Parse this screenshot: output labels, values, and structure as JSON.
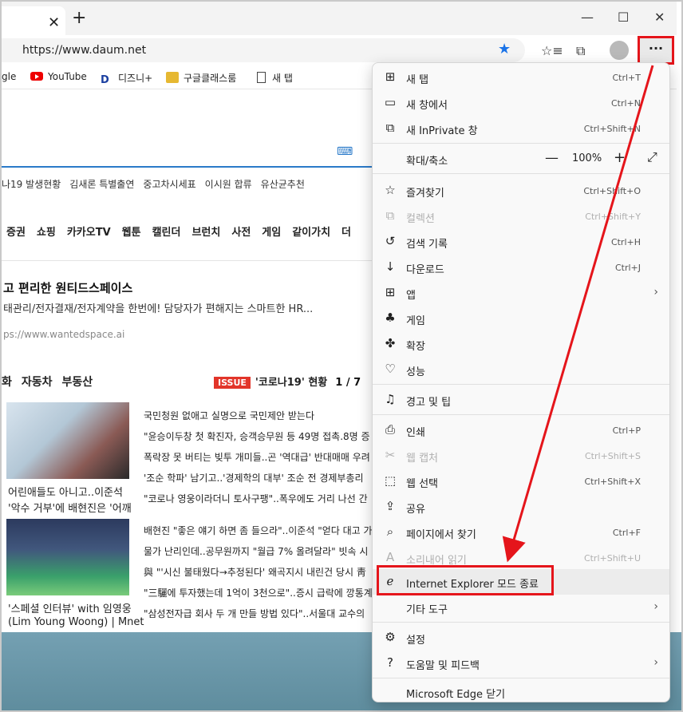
{
  "browser": {
    "tab_close": "✕",
    "new_tab": "+",
    "window_controls": {
      "minimize": "—",
      "maximize": "☐",
      "close": "✕"
    },
    "url": "https://www.daum.net",
    "more_button": "···"
  },
  "favorites": [
    {
      "label": "gle",
      "icon": "google-icon"
    },
    {
      "label": "YouTube",
      "icon": "youtube-icon"
    },
    {
      "label": "디즈니+",
      "icon": "disney-icon"
    },
    {
      "label": "구글클래스룸",
      "icon": "classroom-icon"
    },
    {
      "label": "새 탭",
      "icon": "page-icon"
    }
  ],
  "page": {
    "trends": [
      "나19 발생현황",
      "김새론 특별출연",
      "중고차시세표",
      "이시원 합류",
      "유산균추천"
    ],
    "nav": [
      "증권",
      "쇼핑",
      "카카오TV",
      "웹툰",
      "캘린더",
      "브런치",
      "사전",
      "게임",
      "같이가치",
      "더"
    ],
    "ad_title": "고 편리한 원티드스페이스",
    "ad_desc": "태관리/전자결재/전자계약을 한번에! 담당자가 편해지는 스마트한 HR...",
    "ad_url": "ps://www.wantedspace.ai",
    "news_tabs": [
      "화",
      "자동차",
      "부동산"
    ],
    "issue_badge": "ISSUE",
    "issue_text": "'코로나19' 현황",
    "issue_page": "1 / 7",
    "thumb1_caption": [
      "어린애들도 아니고..이준석",
      "'악수 거부'에 배현진은 '어깨"
    ],
    "thumb2_caption": [
      "'스페셜 인터뷰' with 임영웅",
      "(Lim Young Woong) | Mnet"
    ],
    "headlines": [
      "국민청원 없애고 실명으로 국민제안 받는다",
      "\"윤승이두창 첫 확진자, 승객승무원 등 49명 접촉.8명 증",
      "폭락장 못 버티는 빚투 개미들..곤 '역대급' 반대매매 우려",
      "'조순 학파' 남기고..'경제학의 대부' 조순 전 경제부총리",
      "\"코로나 영웅이라더니 토사구팽\"..폭우에도 거리 나선 간",
      "배현진 \"좋은 얘기 하면 좀 들으라\"..이준석 \"얻다 대고 가",
      "물가 난리인데..공무원까지 \"월급 7% 올려달라\" 빗속 시",
      "與 \"'시신 불태웠다→추정된다' 왜곡지시 내린건 당시 靑",
      "\"三驪에 투자했는데 1억이 3천으로\"..증시 급락에 깡통계",
      "\"삼성전자급 회사 두 개 만들 방법 있다\"..서울대 교수의"
    ]
  },
  "menu": {
    "items": [
      {
        "label": "새 탭",
        "shortcut": "Ctrl+T",
        "icon": "new-tab-icon",
        "glyph": "⊞",
        "enabled": true
      },
      {
        "label": "새 창에서",
        "shortcut": "Ctrl+N",
        "icon": "new-window-icon",
        "glyph": "▭",
        "enabled": true
      },
      {
        "label": "새 InPrivate 창",
        "shortcut": "Ctrl+Shift+N",
        "icon": "inprivate-icon",
        "glyph": "⧉",
        "enabled": true
      },
      {
        "label": "확대/축소",
        "icon": "zoom-icon",
        "zoom_minus": "—",
        "zoom_value": "100%",
        "zoom_plus": "+",
        "fullscreen": "⤢"
      },
      {
        "label": "즐겨찾기",
        "shortcut": "Ctrl+Shift+O",
        "icon": "favorites-icon",
        "glyph": "☆",
        "enabled": true
      },
      {
        "label": "컬렉션",
        "shortcut": "Ctrl+Shift+Y",
        "icon": "collections-icon",
        "glyph": "⧉",
        "enabled": false
      },
      {
        "label": "검색 기록",
        "shortcut": "Ctrl+H",
        "icon": "history-icon",
        "glyph": "↺",
        "enabled": true
      },
      {
        "label": "다운로드",
        "shortcut": "Ctrl+J",
        "icon": "download-icon",
        "glyph": "↓",
        "enabled": true
      },
      {
        "label": "앱",
        "icon": "apps-icon",
        "glyph": "⊞",
        "enabled": true,
        "submenu": "›"
      },
      {
        "label": "게임",
        "icon": "games-icon",
        "glyph": "♣",
        "enabled": true
      },
      {
        "label": "확장",
        "icon": "extensions-icon",
        "glyph": "✤",
        "enabled": true
      },
      {
        "label": "성능",
        "icon": "performance-icon",
        "glyph": "♡",
        "enabled": true
      },
      {
        "label": "경고 및 팁",
        "icon": "alerts-icon",
        "glyph": "♫",
        "enabled": true
      },
      {
        "label": "인쇄",
        "shortcut": "Ctrl+P",
        "icon": "print-icon",
        "glyph": "⎙",
        "enabled": true
      },
      {
        "label": "웹 캡처",
        "shortcut": "Ctrl+Shift+S",
        "icon": "web-capture-icon",
        "glyph": "✂",
        "enabled": false
      },
      {
        "label": "웹 선택",
        "shortcut": "Ctrl+Shift+X",
        "icon": "web-select-icon",
        "glyph": "⬚",
        "enabled": true
      },
      {
        "label": "공유",
        "icon": "share-icon",
        "glyph": "⇪",
        "enabled": true
      },
      {
        "label": "페이지에서 찾기",
        "shortcut": "Ctrl+F",
        "icon": "find-icon",
        "glyph": "⌕",
        "enabled": true
      },
      {
        "label": "소리내어 읽기",
        "shortcut": "Ctrl+Shift+U",
        "icon": "read-aloud-icon",
        "glyph": "A",
        "enabled": false
      },
      {
        "label": "Internet Explorer 모드 종료",
        "icon": "ie-mode-icon",
        "glyph": "ℯ",
        "enabled": true,
        "highlighted": true
      },
      {
        "label": "기타 도구",
        "icon": "more-tools-icon",
        "glyph": "",
        "enabled": true,
        "submenu": "›"
      },
      {
        "label": "설정",
        "icon": "settings-icon",
        "glyph": "⚙",
        "enabled": true
      },
      {
        "label": "도움말 및 피드백",
        "icon": "help-icon",
        "glyph": "?",
        "enabled": true,
        "submenu": "›"
      },
      {
        "label": "Microsoft Edge 닫기",
        "icon": "",
        "glyph": "",
        "enabled": true
      }
    ]
  },
  "annotation": {
    "highlight_color": "#e5151b"
  }
}
